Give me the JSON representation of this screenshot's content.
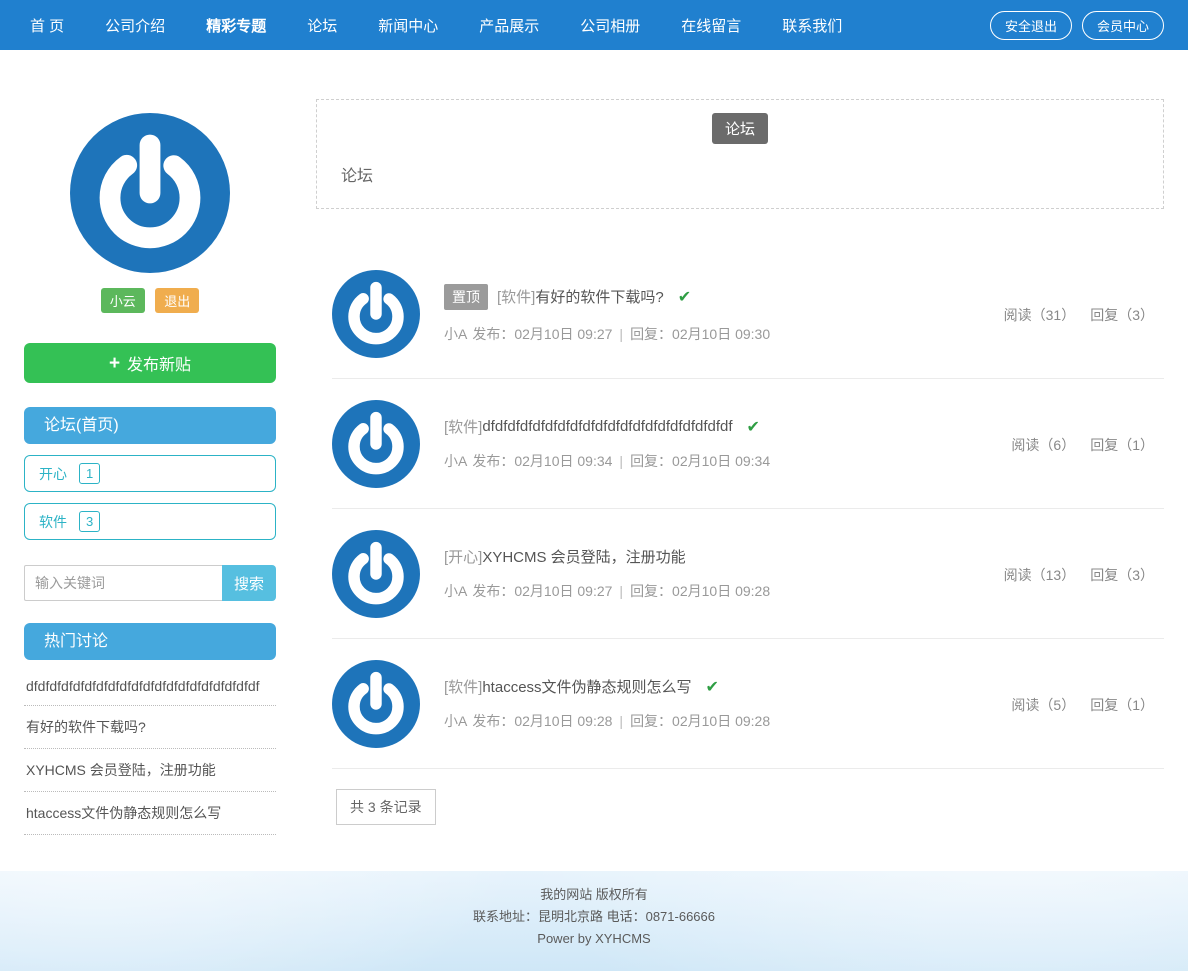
{
  "nav": {
    "items": [
      {
        "label": "首 页"
      },
      {
        "label": "公司介绍"
      },
      {
        "label": "精彩专题"
      },
      {
        "label": "论坛"
      },
      {
        "label": "新闻中心"
      },
      {
        "label": "产品展示"
      },
      {
        "label": "公司相册"
      },
      {
        "label": "在线留言"
      },
      {
        "label": "联系我们"
      }
    ],
    "logout_button": "安全退出",
    "member_button": "会员中心"
  },
  "sidebar": {
    "user": {
      "name": "小云",
      "logout": "退出"
    },
    "new_post_button": {
      "plus": "+",
      "label": "发布新贴"
    },
    "board_header": "论坛(首页)",
    "categories": [
      {
        "name": "开心",
        "count": "1"
      },
      {
        "name": "软件",
        "count": "3"
      }
    ],
    "search": {
      "placeholder": "输入关键词",
      "button": "搜索"
    },
    "hot_header": "热门讨论",
    "hot_topics": [
      "dfdfdfdfdfdfdfdfdfdfdfdfdfdfdfdfdfdfdfdf",
      "有好的软件下载吗?",
      "XYHCMS 会员登陆，注册功能",
      "htaccess文件伪静态规则怎么写"
    ]
  },
  "main": {
    "tab_label": "论坛",
    "breadcrumb": "论坛",
    "record_count": "共 3 条记录"
  },
  "posts": {
    "meta_divider": "|",
    "items": [
      {
        "pinned": true,
        "pin_label": "置顶",
        "category": "[软件]",
        "title": "有好的软件下载吗?",
        "solved": true,
        "check": "✔",
        "author": "小A",
        "publish": "发布：02月10日 09:27",
        "reply": "回复：02月10日 09:30",
        "read_count": "阅读（31）",
        "reply_count": "回复（3）"
      },
      {
        "pinned": false,
        "category": "[软件]",
        "title": "dfdfdfdfdfdfdfdfdfdfdfdfdfdfdfdfdfdfdfdf",
        "solved": true,
        "check": "✔",
        "author": "小A",
        "publish": "发布：02月10日 09:34",
        "reply": "回复：02月10日 09:34",
        "read_count": "阅读（6）",
        "reply_count": "回复（1）"
      },
      {
        "pinned": false,
        "category": "[开心]",
        "title": "XYHCMS 会员登陆，注册功能",
        "solved": false,
        "author": "小A",
        "publish": "发布：02月10日 09:27",
        "reply": "回复：02月10日 09:28",
        "read_count": "阅读（13）",
        "reply_count": "回复（3）"
      },
      {
        "pinned": false,
        "category": "[软件]",
        "title": "htaccess文件伪静态规则怎么写",
        "solved": true,
        "check": "✔",
        "author": "小A",
        "publish": "发布：02月10日 09:28",
        "reply": "回复：02月10日 09:28",
        "read_count": "阅读（5）",
        "reply_count": "回复（1）"
      }
    ]
  },
  "footer": {
    "lines": [
      "我的网站 版权所有",
      "联系地址：昆明北京路 电话：0871-66666",
      "Power by XYHCMS"
    ]
  },
  "colors": {
    "nav-blue": "#2080cf",
    "panel-blue": "#45a8dd",
    "teal": "#2cb3c6",
    "green": "#34c155",
    "badge-green": "#5cb85c",
    "badge-orange": "#f0ad4e",
    "search-blue": "#56bfe0",
    "check-green": "#2f9e44",
    "logo-blue": "#1e74ba",
    "pin-gray": "#9b9b9b"
  }
}
